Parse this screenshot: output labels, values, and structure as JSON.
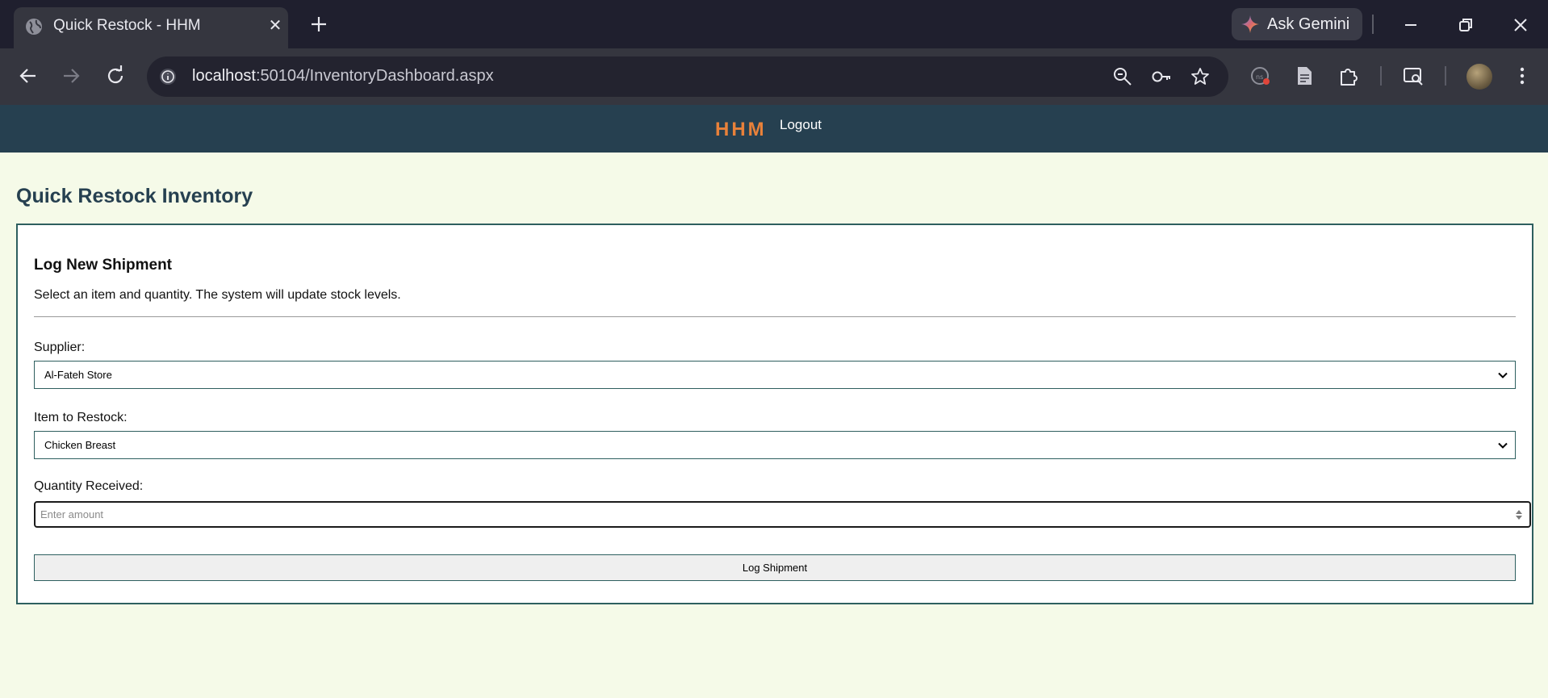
{
  "browser": {
    "tab_title": "Quick Restock - HHM",
    "tab_close_glyph": "✕",
    "ask_gemini_label": "Ask Gemini",
    "url_host": "localhost",
    "url_rest": ":50104/InventoryDashboard.aspx",
    "icons": [
      "globe-icon",
      "close-icon",
      "plus-icon",
      "gemini-spark-icon",
      "minimize-icon",
      "restore-icon",
      "close-window-icon",
      "back-icon",
      "forward-icon",
      "reload-icon",
      "site-info-icon",
      "zoom-icon",
      "password-key-icon",
      "bookmark-star-icon",
      "extension-icon",
      "document-icon",
      "puzzle-icon",
      "search-panel-icon",
      "avatar",
      "more-vert-icon"
    ]
  },
  "site": {
    "brand": "HHM",
    "logout_label": "Logout",
    "brand_color": "#e8813a",
    "header_color": "#264050"
  },
  "page": {
    "title": "Quick Restock Inventory",
    "card": {
      "title": "Log New Shipment",
      "description": "Select an item and quantity. The system will update stock levels.",
      "supplier_label": "Supplier:",
      "supplier_value": "Al-Fateh Store",
      "item_label": "Item to Restock:",
      "item_value": "Chicken Breast",
      "quantity_label": "Quantity Received:",
      "quantity_placeholder": "Enter amount",
      "submit_label": "Log Shipment"
    }
  }
}
